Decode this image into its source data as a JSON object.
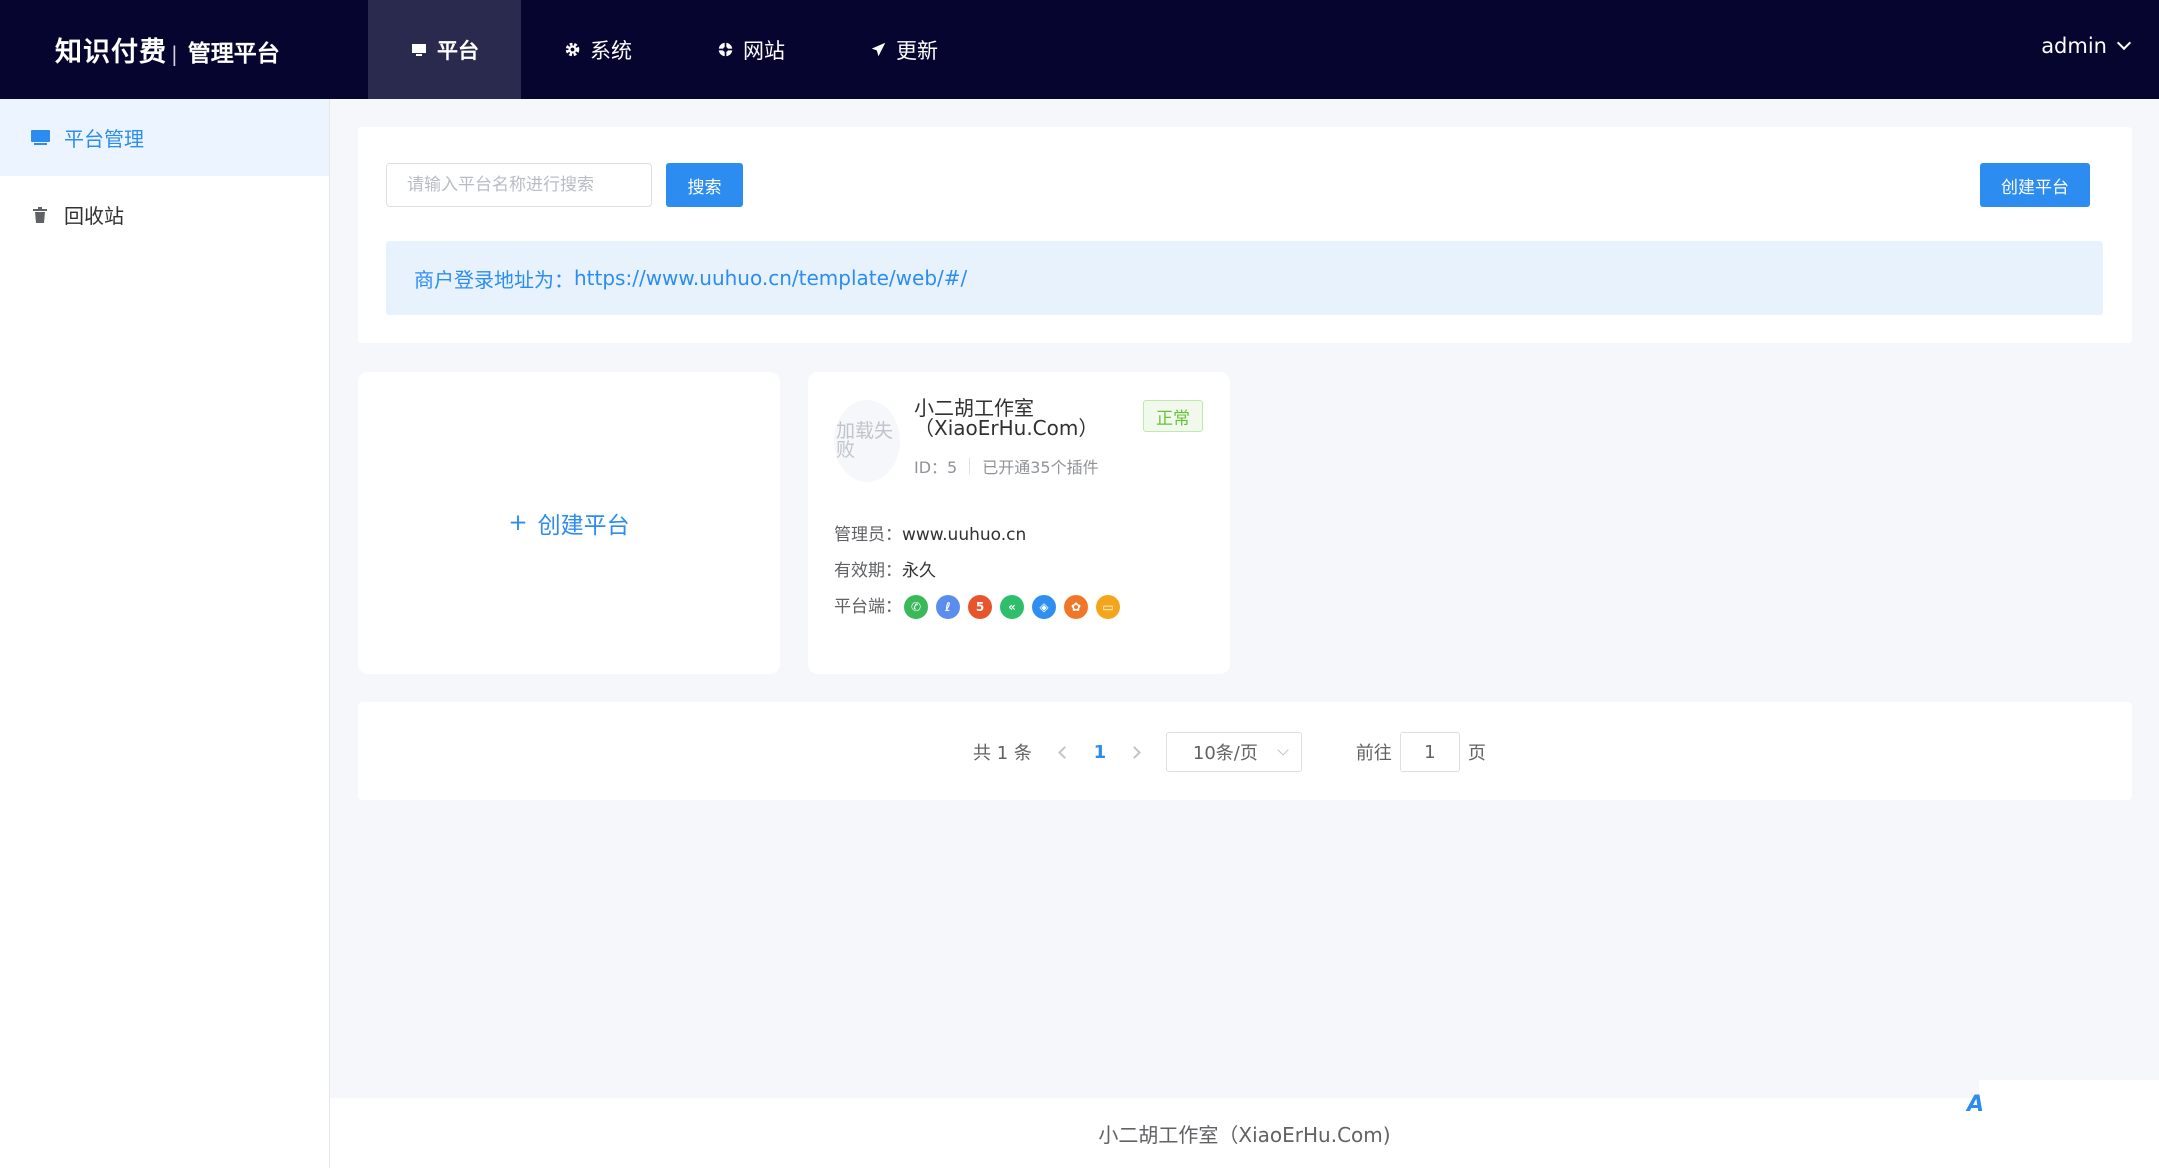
{
  "header": {
    "logo_main": "知识付费",
    "logo_sep": "|",
    "logo_sub": "管理平台",
    "nav": [
      {
        "label": "平台",
        "icon": "monitor-icon",
        "active": true
      },
      {
        "label": "系统",
        "icon": "gear-icon",
        "active": false
      },
      {
        "label": "网站",
        "icon": "globe-icon",
        "active": false
      },
      {
        "label": "更新",
        "icon": "send-icon",
        "active": false
      }
    ],
    "user": "admin"
  },
  "sidebar": {
    "items": [
      {
        "label": "平台管理",
        "icon": "monitor-icon",
        "active": true
      },
      {
        "label": "回收站",
        "icon": "trash-icon",
        "active": false
      }
    ]
  },
  "toolbar": {
    "search_placeholder": "请输入平台名称进行搜索",
    "search_label": "搜索",
    "create_label": "创建平台"
  },
  "notice": {
    "label": "商户登录地址为：",
    "url": "https://www.uuhuo.cn/template/web/#/"
  },
  "create_card": {
    "plus": "+",
    "label": "创建平台"
  },
  "platform_card": {
    "avatar_alt": "加载失败",
    "name": "小二胡工作室（XiaoErHu.Com）",
    "status": "正常",
    "id_label": "ID：5",
    "plugins": "已开通35个插件",
    "admin_label": "管理员：",
    "admin_value": "www.uuhuo.cn",
    "validity_label": "有效期：",
    "validity_value": "永久",
    "platforms_label": "平台端：",
    "platforms": [
      {
        "icon": "wechat-icon",
        "color": "#3bb85a",
        "glyph": "✆"
      },
      {
        "icon": "miniprogram-icon",
        "color": "#5b8def",
        "glyph": "ℓ"
      },
      {
        "icon": "h5-icon",
        "color": "#e8542c",
        "glyph": "5"
      },
      {
        "icon": "app-icon",
        "color": "#2fbf6b",
        "glyph": "«"
      },
      {
        "icon": "baidu-icon",
        "color": "#2e8ff0",
        "glyph": "◈"
      },
      {
        "icon": "toutiao-icon",
        "color": "#f0772a",
        "glyph": "✿"
      },
      {
        "icon": "pc-icon",
        "color": "#f5a51b",
        "glyph": "▭"
      }
    ]
  },
  "pagination": {
    "total": "共 1 条",
    "current": "1",
    "page_size": "10条/页",
    "goto_label": "前往",
    "goto_value": "1",
    "page_suffix": "页"
  },
  "footer": {
    "text": "小二胡工作室（XiaoErHu.Com)"
  },
  "colors": {
    "topbar": "#050530",
    "primary": "#2d8cf0",
    "success": "#67c23a"
  }
}
